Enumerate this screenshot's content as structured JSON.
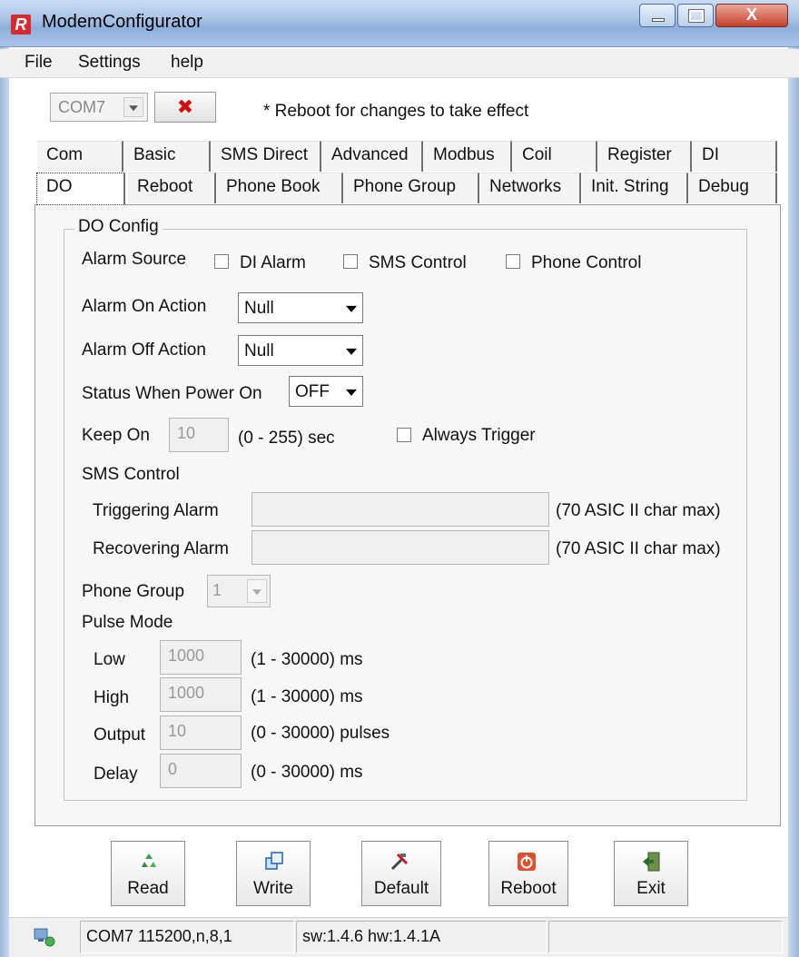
{
  "window": {
    "app_title": "ModemConfigurator",
    "logo_letter": "R",
    "close_glyph": "X"
  },
  "menu": {
    "file": "File",
    "settings": "Settings",
    "help": "help"
  },
  "toolbar": {
    "com_port": "COM7",
    "reboot_note": "* Reboot for changes to take effect",
    "disconnect_glyph": "✖"
  },
  "tabs_row1": [
    "Com",
    "Basic",
    "SMS Direct",
    "Advanced",
    "Modbus",
    "Coil",
    "Register",
    "DI"
  ],
  "tabs_row2": [
    "DO",
    "Reboot",
    "Phone Book",
    "Phone Group",
    "Networks",
    "Init. String",
    "Debug"
  ],
  "active_tab": "DO",
  "do_config": {
    "group_title": "DO Config",
    "alarm_source_label": "Alarm Source",
    "di_alarm_label": "DI Alarm",
    "sms_control_label": "SMS Control",
    "phone_control_label": "Phone Control",
    "alarm_on_action_label": "Alarm On Action",
    "alarm_on_action_value": "Null",
    "alarm_off_action_label": "Alarm Off Action",
    "alarm_off_action_value": "Null",
    "status_power_on_label": "Status When Power On",
    "status_power_on_value": "OFF",
    "keep_on_label": "Keep On",
    "keep_on_value": "10",
    "keep_on_range": "(0 - 255) sec",
    "always_trigger_label": "Always Trigger",
    "sms_control_section": "SMS Control",
    "triggering_alarm_label": "Triggering Alarm",
    "triggering_alarm_value": "",
    "triggering_alarm_hint": "(70 ASIC II char max)",
    "recovering_alarm_label": "Recovering Alarm",
    "recovering_alarm_value": "",
    "recovering_alarm_hint": "(70 ASIC II char max)",
    "phone_group_label": "Phone Group",
    "phone_group_value": "1",
    "pulse_mode_label": "Pulse Mode",
    "low_label": "Low",
    "low_value": "1000",
    "low_range": "(1 - 30000) ms",
    "high_label": "High",
    "high_value": "1000",
    "high_range": "(1 - 30000) ms",
    "output_label": "Output",
    "output_value": "10",
    "output_range": "(0 - 30000) pulses",
    "delay_label": "Delay",
    "delay_value": "0",
    "delay_range": "(0 - 30000) ms"
  },
  "buttons": {
    "read": "Read",
    "write": "Write",
    "default": "Default",
    "reboot": "Reboot",
    "exit": "Exit"
  },
  "status": {
    "connection": "COM7 115200,n,8,1",
    "version": "sw:1.4.6 hw:1.4.1A",
    "extra": ""
  }
}
